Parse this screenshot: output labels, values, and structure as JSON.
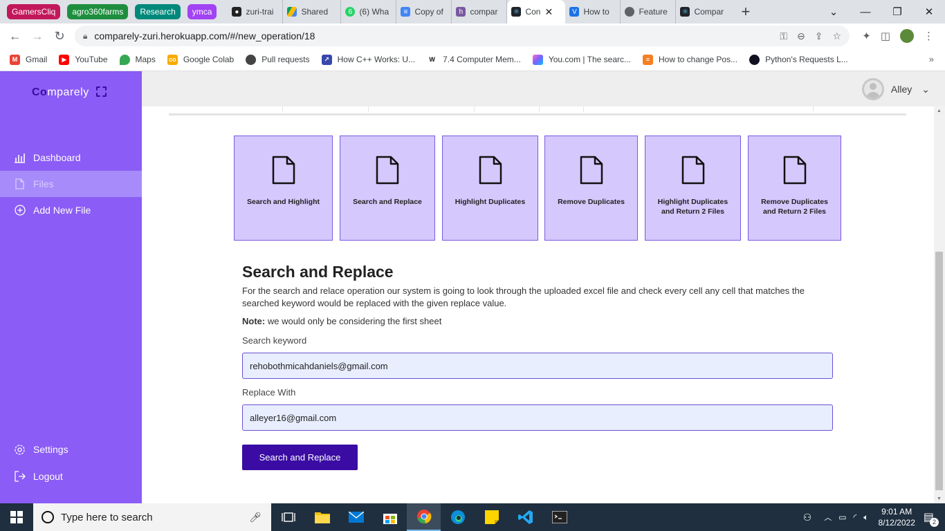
{
  "browser": {
    "tab_groups": [
      {
        "label": "GamersCliq",
        "color": "#c2185b"
      },
      {
        "label": "agro360farms",
        "color": "#1e8e3e"
      },
      {
        "label": "Research",
        "color": "#00897b"
      },
      {
        "label": "ymca",
        "color": "#a142f4"
      }
    ],
    "tabs": [
      {
        "title": "zuri-trai",
        "icon": "github-icon"
      },
      {
        "title": "Shared",
        "icon": "drive-icon"
      },
      {
        "title": "(6) Wha",
        "icon": "whatsapp-icon",
        "badge": "6"
      },
      {
        "title": "Copy of",
        "icon": "docs-icon"
      },
      {
        "title": "compar",
        "icon": "heroku-icon"
      },
      {
        "title": "Con",
        "icon": "react-icon",
        "active": true
      },
      {
        "title": "How to",
        "icon": "vercel-icon"
      },
      {
        "title": "Feature",
        "icon": "globe-icon"
      },
      {
        "title": "Compar",
        "icon": "react-icon"
      }
    ],
    "url": "comparely-zuri.herokuapp.com/#/new_operation/18",
    "bookmarks": [
      {
        "label": "Gmail",
        "icon": "gmail-icon"
      },
      {
        "label": "YouTube",
        "icon": "youtube-icon"
      },
      {
        "label": "Maps",
        "icon": "maps-icon"
      },
      {
        "label": "Google Colab",
        "icon": "colab-icon"
      },
      {
        "label": "Pull requests",
        "icon": "github-icon"
      },
      {
        "label": "How C++ Works: U...",
        "icon": "cpp-icon"
      },
      {
        "label": "7.4 Computer Mem...",
        "icon": "w-icon"
      },
      {
        "label": "You.com | The searc...",
        "icon": "youcom-icon"
      },
      {
        "label": "How to change Pos...",
        "icon": "stackoverflow-icon"
      },
      {
        "label": "Python's Requests L...",
        "icon": "realpython-icon"
      }
    ]
  },
  "app": {
    "logo_bold": "Co",
    "logo_rest": "mparely",
    "nav": [
      {
        "label": "Dashboard",
        "icon": "bar-chart-icon"
      },
      {
        "label": "Files",
        "icon": "file-icon",
        "active": true
      },
      {
        "label": "Add New File",
        "icon": "plus-circle-icon"
      }
    ],
    "nav_bottom": [
      {
        "label": "Settings",
        "icon": "gear-icon"
      },
      {
        "label": "Logout",
        "icon": "logout-icon"
      }
    ],
    "user_name": "Alley",
    "operations": [
      {
        "label": "Search and Highlight"
      },
      {
        "label": "Search and Replace"
      },
      {
        "label": "Highlight Duplicates"
      },
      {
        "label": "Remove Duplicates"
      },
      {
        "label": "Highlight Duplicates and Return 2 Files"
      },
      {
        "label": "Remove Duplicates and Return 2 Files"
      }
    ],
    "form": {
      "title": "Search and Replace",
      "description": "For the search and relace operation our system is going to look through the uploaded excel file and check every cell any cell that matches the searched keyword would be replaced with the given replace value.",
      "note_label": "Note:",
      "note_text": "we would only be considering the first sheet",
      "search_label": "Search keyword",
      "search_value": "rehobothmicahdaniels@gmail.com",
      "replace_label": "Replace With",
      "replace_value": "alleyer16@gmail.com",
      "submit_label": "Search and Replace"
    },
    "colors": {
      "sidebar": "#8b5cf6",
      "card": "#d5c8fc",
      "button": "#3a0ca3"
    }
  },
  "taskbar": {
    "search_placeholder": "Type here to search",
    "time": "9:01 AM",
    "date": "8/12/2022",
    "notification_count": "2"
  }
}
